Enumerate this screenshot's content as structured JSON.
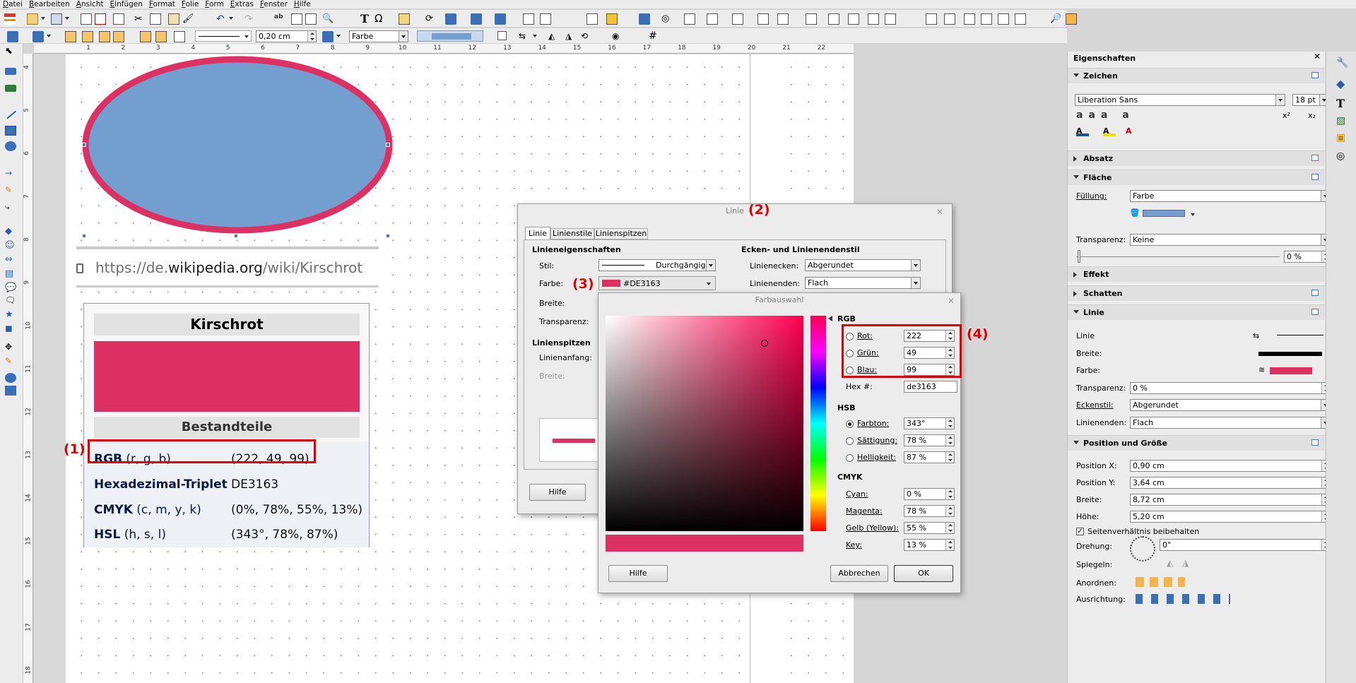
{
  "menu": [
    "Datei",
    "Bearbeiten",
    "Ansicht",
    "Einfügen",
    "Format",
    "Folie",
    "Form",
    "Extras",
    "Fenster",
    "Hilfe"
  ],
  "line_toolbar": {
    "width_value": "0,20 cm",
    "area_style": "Farbe",
    "area_color": "#729fcf"
  },
  "ruler": {
    "h_ticks": [
      "1",
      "2",
      "3",
      "4",
      "5",
      "6",
      "7",
      "8",
      "9",
      "10",
      "11",
      "12",
      "13",
      "14",
      "15",
      "16",
      "17",
      "18",
      "19",
      "20",
      "21",
      "22"
    ],
    "v_ticks": [
      "4",
      "5",
      "6",
      "7",
      "8",
      "9",
      "10",
      "11",
      "12",
      "13",
      "14",
      "15",
      "16",
      "17",
      "18"
    ]
  },
  "ellipse": {
    "fill": "#729fcf",
    "stroke": "#de3163"
  },
  "browser_url": {
    "prefix": "https://de.",
    "domain": "wikipedia.org",
    "path": "/wiki/Kirschrot"
  },
  "wiki_box": {
    "title": "Kirschrot",
    "swatch_color": "#de3163",
    "section": "Bestandteile",
    "rows": [
      {
        "key": "RGB",
        "sub": "(r, g, b)",
        "value": "(222, 49, 99)"
      },
      {
        "key": "Hexadezimal-Triplet",
        "sub": "",
        "value": "DE3163"
      },
      {
        "key": "CMYK",
        "sub": "(c, m, y, k)",
        "value": "(0%, 78%, 55%, 13%)"
      },
      {
        "key": "HSL",
        "sub": "(h, s, l)",
        "value": "(343°, 78%, 87%)"
      }
    ]
  },
  "annotations": [
    "(1)",
    "(2)",
    "(3)",
    "(4)"
  ],
  "line_dialog": {
    "title": "Linie",
    "tabs": [
      "Linie",
      "Linienstile",
      "Linienspitzen"
    ],
    "props_header": "Linieneigenschaften",
    "stil_label": "Stil:",
    "stil_value": "Durchgängig",
    "farbe_label": "Farbe:",
    "farbe_value": "#DE3163",
    "breite_label": "Breite:",
    "transparenz_label": "Transparenz:",
    "spitzen_header": "Linienspitzen",
    "anfang_label": "Linienanfang:",
    "breite2_label": "Breite:",
    "ecken_header": "Ecken- und Linienendenstil",
    "ecken_label": "Linienecken:",
    "ecken_value": "Abgerundet",
    "enden_label": "Linienenden:",
    "enden_value": "Flach",
    "help_button": "Hilfe"
  },
  "color_dialog": {
    "title": "Farbauswahl",
    "rgb_header": "RGB",
    "rot_label": "Rot:",
    "rot_value": "222",
    "gruen_label": "Grün:",
    "gruen_value": "49",
    "blau_label": "Blau:",
    "blau_value": "99",
    "hex_label": "Hex #:",
    "hex_value": "de3163",
    "hsb_header": "HSB",
    "farbton_label": "Farbton:",
    "farbton_value": "343°",
    "saettigung_label": "Sättigung:",
    "saettigung_value": "78 %",
    "helligkeit_label": "Helligkeit:",
    "helligkeit_value": "87 %",
    "cmyk_header": "CMYK",
    "cyan_label": "Cyan:",
    "cyan_value": "0 %",
    "magenta_label": "Magenta:",
    "magenta_value": "78 %",
    "gelb_label": "Gelb (Yellow):",
    "gelb_value": "55 %",
    "key_label": "Key:",
    "key_value": "13 %",
    "preview_color": "#de3163",
    "help_button": "Hilfe",
    "cancel_button": "Abbrechen",
    "ok_button": "OK"
  },
  "sidebar": {
    "title": "Eigenschaften",
    "zeichen_header": "Zeichen",
    "font_name": "Liberation Sans",
    "font_size": "18 pt",
    "absatz_header": "Absatz",
    "flaeche_header": "Fläche",
    "fuellung_label": "Füllung:",
    "fuellung_value": "Farbe",
    "fill_color": "#729fcf",
    "transparenz_label": "Transparenz:",
    "transparenz_value": "Keine",
    "transparenz_percent": "0 %",
    "effekt_header": "Effekt",
    "schatten_header": "Schatten",
    "linie_header": "Linie",
    "linie_label": "Linie",
    "breite_label": "Breite:",
    "farbe_label": "Farbe:",
    "line_color": "#de3163",
    "line_transparenz_label": "Transparenz:",
    "line_transparenz_value": "0 %",
    "eckenstil_label": "Eckenstil:",
    "eckenstil_value": "Abgerundet",
    "linienenden_label": "Linienenden:",
    "linienenden_value": "Flach",
    "pos_header": "Position und Größe",
    "pos_x_label": "Position X:",
    "pos_x_value": "0,90 cm",
    "pos_y_label": "Position Y:",
    "pos_y_value": "3,64 cm",
    "breite2_label": "Breite:",
    "breite2_value": "8,72 cm",
    "hoehe_label": "Höhe:",
    "hoehe_value": "5,20 cm",
    "keep_ratio_label": "Seitenverhältnis beibehalten",
    "drehung_label": "Drehung:",
    "drehung_value": "0°",
    "spiegeln_label": "Spiegeln:",
    "anordnen_label": "Anordnen:",
    "ausrichtung_label": "Ausrichtung:"
  }
}
